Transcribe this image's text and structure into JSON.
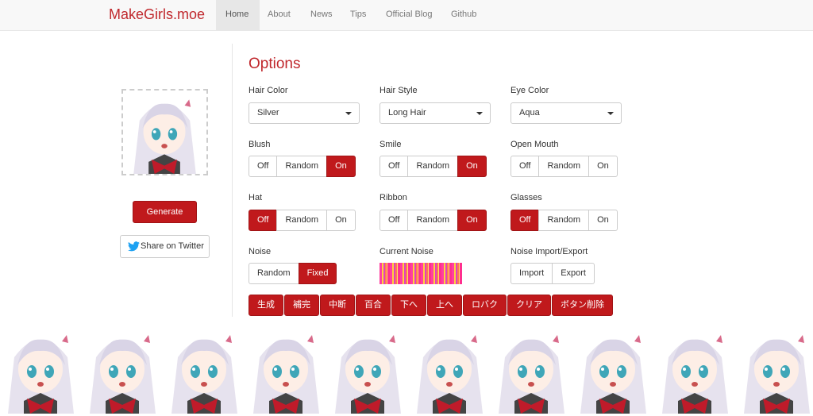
{
  "nav": {
    "brand": "MakeGirls.moe",
    "items": [
      {
        "label": "Home",
        "active": true
      },
      {
        "label": "About"
      },
      {
        "label": "News"
      },
      {
        "label": "Tips"
      },
      {
        "label": "Official Blog"
      },
      {
        "label": "Github"
      }
    ]
  },
  "left": {
    "generate": "Generate",
    "twitter": "Share on Twitter"
  },
  "options": {
    "title": "Options",
    "hair_color": {
      "label": "Hair Color",
      "value": "Silver"
    },
    "hair_style": {
      "label": "Hair Style",
      "value": "Long Hair"
    },
    "eye_color": {
      "label": "Eye Color",
      "value": "Aqua"
    },
    "blush": {
      "label": "Blush",
      "off": "Off",
      "random": "Random",
      "on": "On",
      "selected": "On"
    },
    "smile": {
      "label": "Smile",
      "off": "Off",
      "random": "Random",
      "on": "On",
      "selected": "On"
    },
    "open_mouth": {
      "label": "Open Mouth",
      "off": "Off",
      "random": "Random",
      "on": "On",
      "selected": "none"
    },
    "hat": {
      "label": "Hat",
      "off": "Off",
      "random": "Random",
      "on": "On",
      "selected": "Off"
    },
    "ribbon": {
      "label": "Ribbon",
      "off": "Off",
      "random": "Random",
      "on": "On",
      "selected": "On"
    },
    "glasses": {
      "label": "Glasses",
      "off": "Off",
      "random": "Random",
      "on": "On",
      "selected": "Off"
    },
    "noise": {
      "label": "Noise",
      "random": "Random",
      "fixed": "Fixed",
      "selected": "Fixed"
    },
    "current_noise": {
      "label": "Current Noise"
    },
    "noise_io": {
      "label": "Noise Import/Export",
      "import": "Import",
      "export": "Export"
    }
  },
  "actions": [
    "生成",
    "補完",
    "中断",
    "百合",
    "下へ",
    "上へ",
    "ロバク",
    "クリア",
    "ボタン削除"
  ],
  "colors": {
    "accent": "#c0191c",
    "brand": "#c0282d"
  }
}
